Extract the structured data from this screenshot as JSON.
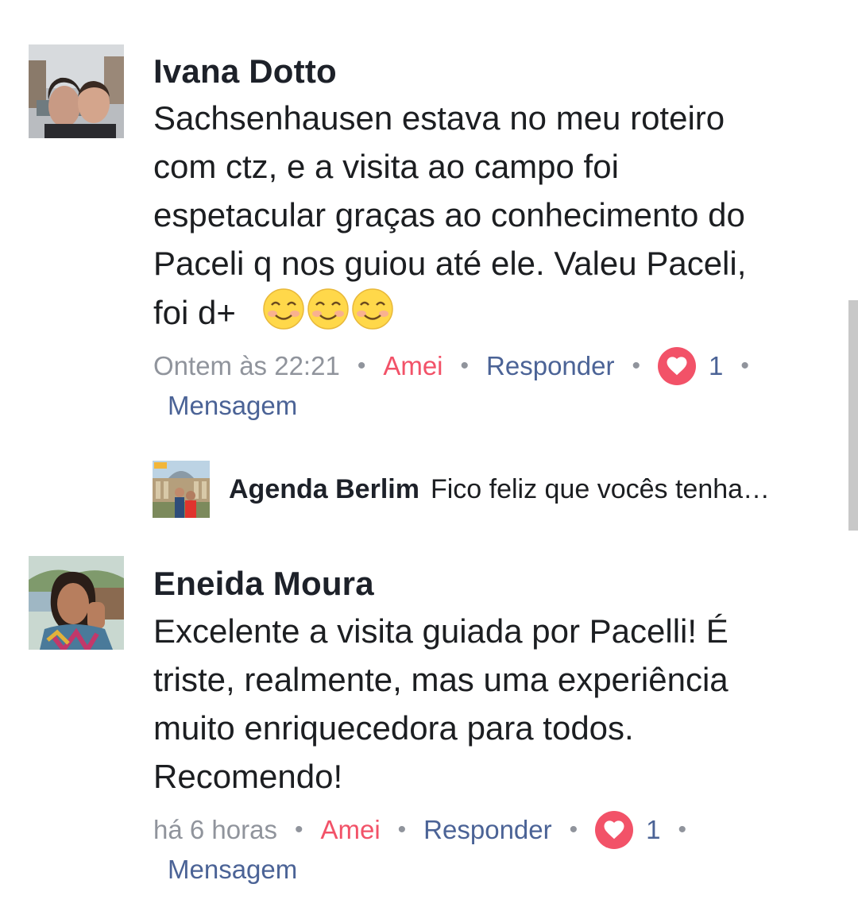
{
  "comments": [
    {
      "author": "Ivana Dotto",
      "lines": [
        "Sachsenhausen estava no meu roteiro",
        "com ctz, e a visita ao campo foi",
        "espetacular graças ao conhecimento do",
        "Paceli q nos guiou até ele. Valeu Paceli,",
        "foi d+"
      ],
      "emoji_icon": "smiling-face-with-smiling-eyes",
      "emoji_count": 3,
      "time": "Ontem às 22:21",
      "like_label": "Amei",
      "reply_label": "Responder",
      "reaction_icon": "heart-icon",
      "reaction_count": "1",
      "message_label": "Mensagem",
      "reply_preview": {
        "author": "Agenda Berlim",
        "text": "Fico feliz que vocês tenha…"
      }
    },
    {
      "author": "Eneida Moura",
      "lines": [
        "Excelente a visita guiada por Pacelli! É",
        "triste, realmente, mas uma experiência",
        "muito enriquecedora para todos.",
        "Recomendo!"
      ],
      "time": "há 6 horas",
      "like_label": "Amei",
      "reply_label": "Responder",
      "reaction_icon": "heart-icon",
      "reaction_count": "1",
      "message_label": "Mensagem"
    }
  ],
  "colors": {
    "author": "#1d2129",
    "body": "#1c1e21",
    "meta": "#90949c",
    "love": "#f25268",
    "link": "#4b6396"
  }
}
